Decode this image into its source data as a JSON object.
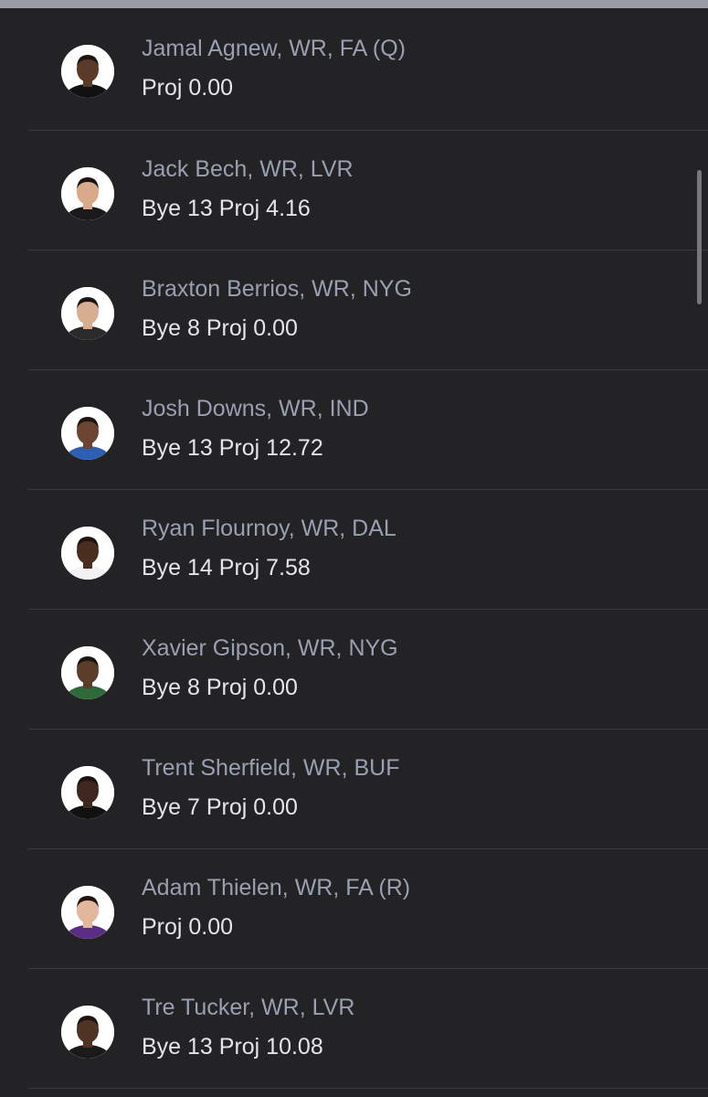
{
  "players": [
    {
      "name": "Jamal Agnew, WR, FA (Q)",
      "info": "Proj 0.00",
      "skin": "#5a3a28",
      "jersey": "#111111"
    },
    {
      "name": "Jack Bech, WR, LVR",
      "info": "Bye 13 Proj 4.16",
      "skin": "#d9a98a",
      "jersey": "#1a1a1a"
    },
    {
      "name": "Braxton Berrios, WR, NYG",
      "info": "Bye 8 Proj 0.00",
      "skin": "#d8ae92",
      "jersey": "#2a2a2a"
    },
    {
      "name": "Josh Downs, WR, IND",
      "info": "Bye 13 Proj 12.72",
      "skin": "#6b4532",
      "jersey": "#2d5fb5"
    },
    {
      "name": "Ryan Flournoy, WR, DAL",
      "info": "Bye 14 Proj 7.58",
      "skin": "#4a2e20",
      "jersey": "#f2f2f2"
    },
    {
      "name": "Xavier Gipson, WR, NYG",
      "info": "Bye 8 Proj 0.00",
      "skin": "#5c3d2c",
      "jersey": "#2f6b3a"
    },
    {
      "name": "Trent Sherfield, WR, BUF",
      "info": "Bye 7 Proj 0.00",
      "skin": "#3e271c",
      "jersey": "#111111"
    },
    {
      "name": "Adam Thielen, WR, FA (R)",
      "info": "Proj 0.00",
      "skin": "#e2b79c",
      "jersey": "#5b2d86"
    },
    {
      "name": "Tre Tucker, WR, LVR",
      "info": "Bye 13 Proj 10.08",
      "skin": "#4f3325",
      "jersey": "#1a1a1a"
    }
  ],
  "colors": {
    "background": "#232225",
    "name_text": "#98a0b2",
    "info_text": "#e5e5e7",
    "divider": "#3a393d"
  }
}
